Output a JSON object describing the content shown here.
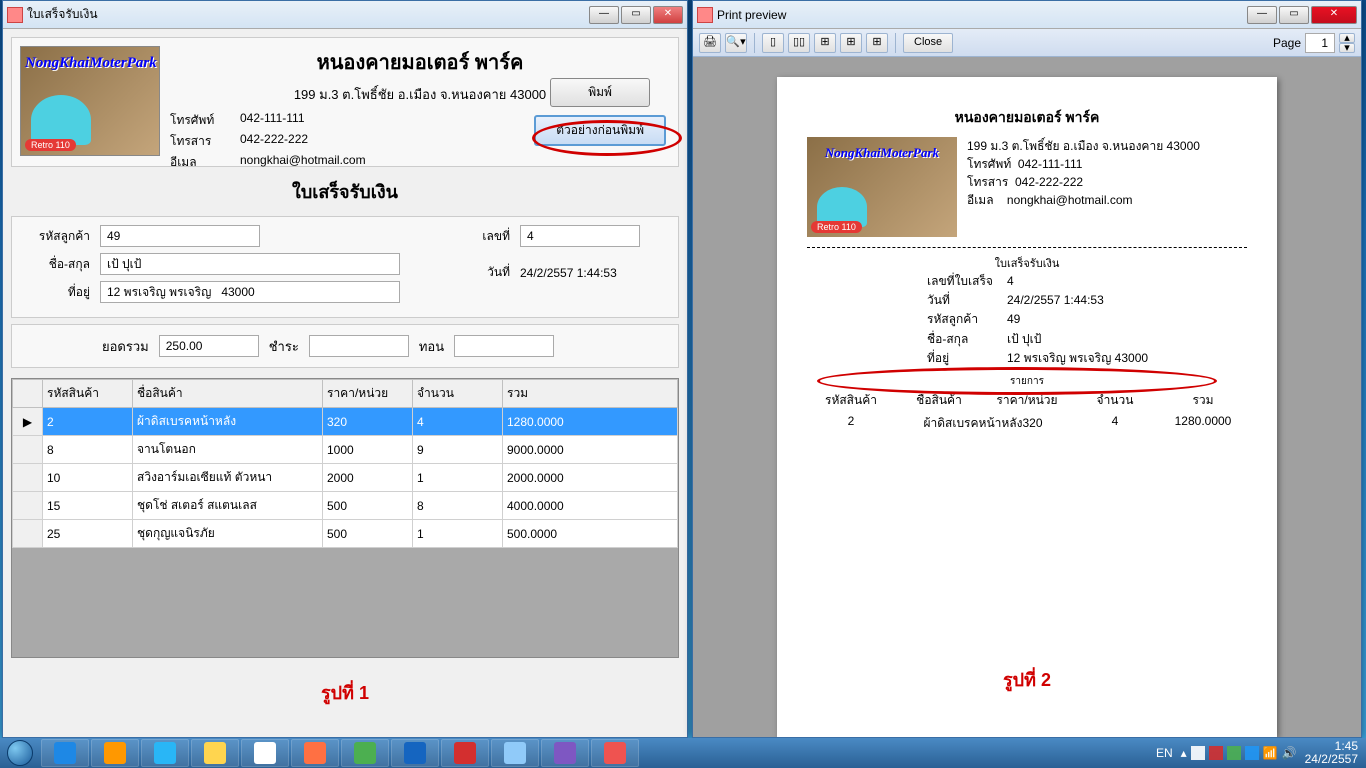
{
  "win1": {
    "title": "ใบเสร็จรับเงิน"
  },
  "win2": {
    "title": "Print preview"
  },
  "business": {
    "name": "หนองคายมอเตอร์ พาร์ค",
    "logo_text": "NongKhaiMoterPark",
    "logo_ribbon": "Retro 110",
    "address": "199 ม.3 ต.โพธิ์ชัย อ.เมือง จ.หนองคาย 43000",
    "phone_lbl": "โทรศัพท์",
    "phone": "042-111-111",
    "fax_lbl": "โทรสาร",
    "fax": "042-222-222",
    "email_lbl": "อีเมล",
    "email": "nongkhai@hotmail.com"
  },
  "buttons": {
    "print": "พิมพ์",
    "preview": "ตัวอย่างก่อนพิมพ์"
  },
  "doc": {
    "title": "ใบเสร็จรับเงิน"
  },
  "form": {
    "customer_id_lbl": "รหัสลูกค้า",
    "customer_id": "49",
    "name_lbl": "ชื่อ-สกุล",
    "name": "เป้ ปุเป้",
    "address_lbl": "ที่อยู่",
    "address": "12 พรเจริญ พรเจริญ   43000",
    "receipt_no_lbl": "เลขที่",
    "receipt_no": "4",
    "date_lbl": "วันที่",
    "date": "24/2/2557 1:44:53"
  },
  "totals": {
    "total_lbl": "ยอดรวม",
    "total": "250.00",
    "pay_lbl": "ชำระ",
    "pay": "",
    "change_lbl": "ทอน",
    "change": ""
  },
  "grid": {
    "headers": [
      "",
      "รหัสสินค้า",
      "ชื่อสินค้า",
      "ราคา/หน่วย",
      "จำนวน",
      "รวม"
    ],
    "rows": [
      {
        "sel": true,
        "marker": "▶",
        "code": "2",
        "name": "ผ้าดิสเบรคหน้าหลัง",
        "price": "320",
        "qty": "4",
        "sum": "1280.0000"
      },
      {
        "code": "8",
        "name": "จานโตนอก",
        "price": "1000",
        "qty": "9",
        "sum": "9000.0000"
      },
      {
        "code": "10",
        "name": "สวิงอาร์มเอเซียแท้ ตัวหนา",
        "price": "2000",
        "qty": "1",
        "sum": "2000.0000"
      },
      {
        "code": "15",
        "name": "ชุดโช่ สเตอร์ สแตนเลส",
        "price": "500",
        "qty": "8",
        "sum": "4000.0000"
      },
      {
        "code": "25",
        "name": "ชุดกุญแจนิรภัย",
        "price": "500",
        "qty": "1",
        "sum": "500.0000"
      }
    ]
  },
  "captions": {
    "fig1": "รูปที่  1",
    "fig2": "รูปที่  2"
  },
  "preview": {
    "toolbar": {
      "close": "Close",
      "page_lbl": "Page",
      "page_no": "1"
    },
    "meta": {
      "receipt_no_lbl": "เลขที่ใบเสร็จ",
      "receipt_no": "4",
      "date_lbl": "วันที่",
      "date": "24/2/2557 1:44:53",
      "customer_id_lbl": "รหัสลูกค้า",
      "customer_id": "49",
      "name_lbl": "ชื่อ-สกุล",
      "name": "เป้ ปุเป้",
      "address_lbl": "ที่อยู่",
      "address": "12 พรเจริญ  พรเจริญ   43000"
    },
    "items_title": "รายการ",
    "item_headers": [
      "รหัสสินค้า",
      "ชื่อสินค้า",
      "ราคา/หน่วย",
      "จำนวน",
      "รวม"
    ],
    "item": {
      "code": "2",
      "name": "ผ้าดิสเบรคหน้าหลัง320",
      "qty": "4",
      "sum": "1280.0000"
    }
  },
  "tray": {
    "lang": "EN",
    "time": "1:45",
    "date": "24/2/2557"
  },
  "task_icons": [
    {
      "name": "ie",
      "color": "#1e88e5"
    },
    {
      "name": "media",
      "color": "#ff9800"
    },
    {
      "name": "app-blue",
      "color": "#29b6f6"
    },
    {
      "name": "explorer",
      "color": "#ffd54f"
    },
    {
      "name": "chrome",
      "color": "#ffffff"
    },
    {
      "name": "firefox",
      "color": "#ff7043"
    },
    {
      "name": "line",
      "color": "#4caf50"
    },
    {
      "name": "word",
      "color": "#1565c0"
    },
    {
      "name": "download",
      "color": "#d32f2f"
    },
    {
      "name": "paint",
      "color": "#90caf9"
    },
    {
      "name": "vs",
      "color": "#7e57c2"
    },
    {
      "name": "app",
      "color": "#ef5350"
    }
  ]
}
